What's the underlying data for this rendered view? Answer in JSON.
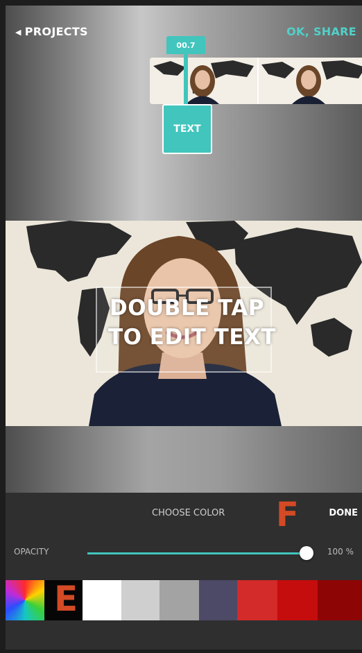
{
  "nav": {
    "back_label": "PROJECTS",
    "share_label": "OK, SHARE"
  },
  "timeline": {
    "time_badge": "00.7",
    "text_track_label": "TEXT"
  },
  "preview": {
    "overlay_line1": "DOUBLE TAP",
    "overlay_line2": "TO EDIT TEXT"
  },
  "color_panel": {
    "title": "CHOOSE COLOR",
    "done_label": "DONE",
    "marker_f": "F",
    "marker_e": "E",
    "opacity_label": "OPACITY",
    "opacity_value": "100 %",
    "opacity_level": 1.0,
    "swatches": [
      {
        "name": "spectrum-swatch",
        "color": "rainbow"
      },
      {
        "name": "black-swatch",
        "color": "#060606"
      },
      {
        "name": "white-swatch",
        "color": "#ffffff"
      },
      {
        "name": "light-gray-swatch",
        "color": "#cfcfcf"
      },
      {
        "name": "gray-swatch",
        "color": "#a3a3a3"
      },
      {
        "name": "slate-swatch",
        "color": "#4c4a66"
      },
      {
        "name": "red-swatch",
        "color": "#d32a2a"
      },
      {
        "name": "bright-red-swatch",
        "color": "#c50d0d"
      },
      {
        "name": "dark-red-swatch",
        "color": "#8e0505"
      }
    ]
  },
  "colors": {
    "accent": "#41c5bd",
    "marker": "#d34a25"
  }
}
